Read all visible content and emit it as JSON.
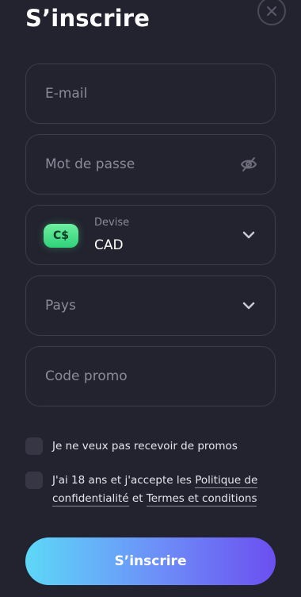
{
  "header": {
    "title": "S’inscrire"
  },
  "form": {
    "email_placeholder": "E-mail",
    "password_placeholder": "Mot de passe",
    "currency": {
      "badge": "C$",
      "label": "Devise",
      "value": "CAD"
    },
    "country_placeholder": "Pays",
    "promo_placeholder": "Code promo"
  },
  "checkboxes": {
    "no_promos": "Je ne veux pas recevoir de promos",
    "age": {
      "text_before": "J'ai 18 ans et j'accepte les ",
      "privacy_link": "Politique de confidentialité",
      "and": " et ",
      "terms_link": "Termes et conditions"
    }
  },
  "submit_label": "S’inscrire",
  "colors": {
    "background": "#23222f",
    "field_border": "#3d3c4b",
    "currency_badge": "#3ddc84",
    "button_gradient_start": "#5dd8f7",
    "button_gradient_end": "#6b4ff0"
  }
}
